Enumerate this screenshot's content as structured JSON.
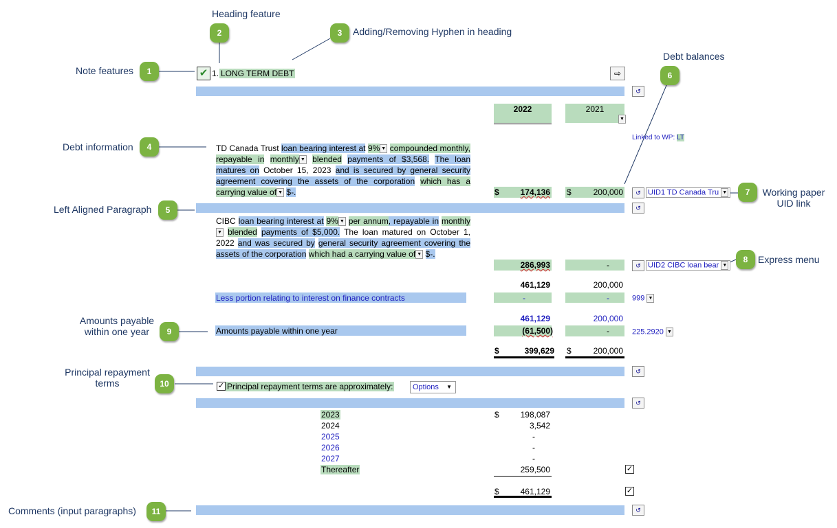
{
  "callouts": {
    "heading_feature": "Heading feature",
    "hyphen": "Adding/Removing Hyphen in heading",
    "note_features": "Note features",
    "debt_balances": "Debt balances",
    "debt_information": "Debt information",
    "working_paper_uid_link": "Working paper UID link",
    "left_aligned_paragraph": "Left Aligned Paragraph",
    "express_menu": "Express menu",
    "amounts_payable": "Amounts payable within one year",
    "principal_repayment_terms": "Principal repayment terms",
    "comments": "Comments (input paragraphs)"
  },
  "badges": [
    "1",
    "2",
    "3",
    "4",
    "5",
    "6",
    "7",
    "8",
    "9",
    "10",
    "11"
  ],
  "heading": {
    "number": "1.",
    "title": "LONG TERM DEBT"
  },
  "columns": {
    "current_year": "2022",
    "prior_year": "2021"
  },
  "linked_wp": {
    "label": "Linked to WP:",
    "code": "LT"
  },
  "td_paragraph": {
    "lender": "TD Canada Trust",
    "t1": "loan bearing interest at",
    "rate": "9%",
    "t2": "compounded monthly, repayable in",
    "freq": "monthly",
    "t3": "blended",
    "t4": "payments of $3,568.",
    "t5": "The loan matures on",
    "date": "October 15, 2023",
    "t6": "and is secured by general security agreement covering the assets of the corporation",
    "t7": "which has a carrying value of",
    "t8": "$-."
  },
  "cibc_paragraph": {
    "lender": "CIBC",
    "t1": "loan bearing interest at",
    "rate": "9%",
    "t2": "per annum",
    "t3": ", repayable in",
    "freq": "monthly",
    "t4": "blended",
    "t5": "payments of $5,000.",
    "t6": "The loan matured on October 1, 2022",
    "t7": "and was secured by",
    "t8": "general security agreement covering the assets of the corporation",
    "t9": "which had a carrying value of",
    "t10": "$-."
  },
  "amounts": {
    "td_dollar_2022": "$",
    "td_2022": "174,136",
    "td_dollar_2021": "$",
    "td_2021": "200,000",
    "cibc_2022": "286,993",
    "cibc_2021": "-",
    "subtotal_2022": "461,129",
    "subtotal_2021": "200,000",
    "less_label": "Less portion relating to interest on finance contracts",
    "less_2022": "-",
    "less_2021": "-",
    "net_2022": "461,129",
    "net_2021": "200,000",
    "payable_label": "Amounts payable within one year",
    "payable_2022": "(61,500)",
    "payable_2021": "-",
    "total_dollar_2022": "$",
    "total_2022": "399,629",
    "total_dollar_2021": "$",
    "total_2021": "200,000"
  },
  "uids": {
    "uid1": "UID1 TD Canada Tru",
    "uid2": "UID2 CIBC loan bear",
    "code999": "999",
    "code225": "225.2920"
  },
  "principal": {
    "label": "Principal repayment terms are approximately:",
    "options": "Options",
    "rows": [
      {
        "year": "2023",
        "dollar": "$",
        "amount": "198,087"
      },
      {
        "year": "2024",
        "dollar": "",
        "amount": "3,542"
      },
      {
        "year": "2025",
        "dollar": "",
        "amount": "-"
      },
      {
        "year": "2026",
        "dollar": "",
        "amount": "-"
      },
      {
        "year": "2027",
        "dollar": "",
        "amount": "-"
      },
      {
        "year": "Thereafter",
        "dollar": "",
        "amount": "259,500"
      }
    ],
    "total_dollar": "$",
    "total": "461,129"
  },
  "icons": {
    "edit": "edit-paragraph-icon",
    "insert": "insert-arrow-icon",
    "check": "checkbox-checked-icon"
  },
  "colors": {
    "blue_band": "#a9c8ee",
    "green_input": "#b9dcbd",
    "badge": "#7cb342",
    "callout_text": "#1f3864"
  }
}
